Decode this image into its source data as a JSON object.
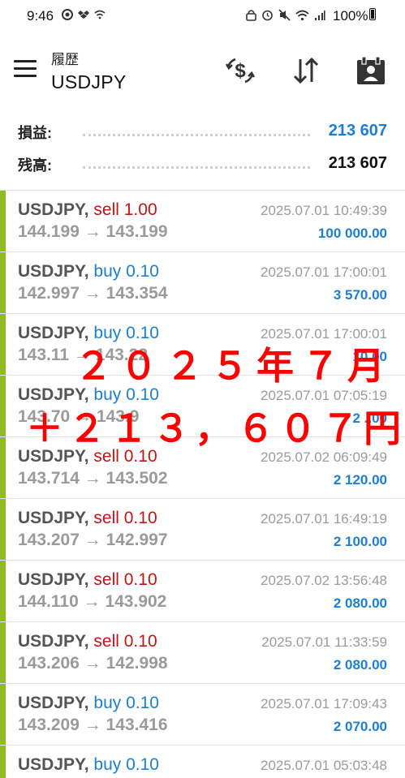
{
  "status_bar": {
    "time": "9:46",
    "battery": "100%"
  },
  "header": {
    "subtitle": "履歴",
    "title": "USDJPY"
  },
  "summary": {
    "profit_label": "損益:",
    "profit_value": "213 607",
    "balance_label": "残高:",
    "balance_value": "213 607"
  },
  "trades": [
    {
      "symbol": "USDJPY,",
      "side": "sell",
      "volume": "1.00",
      "open": "144.199",
      "close": "143.199",
      "time": "2025.07.01 10:49:39",
      "profit": "100 000.00"
    },
    {
      "symbol": "USDJPY,",
      "side": "buy",
      "volume": "0.10",
      "open": "142.997",
      "close": "143.354",
      "time": "2025.07.01 17:00:01",
      "profit": "3 570.00"
    },
    {
      "symbol": "USDJPY,",
      "side": "buy",
      "volume": "0.10",
      "open": "143.11",
      "close": "143.22",
      "time": "2025.07.01 17:00:01",
      "profit": "10.00"
    },
    {
      "symbol": "USDJPY,",
      "side": "buy",
      "volume": "0.10",
      "open": "143.70",
      "close": "143.9",
      "time": "2025.07.01 07:05:19",
      "profit": "2 ..00"
    },
    {
      "symbol": "USDJPY,",
      "side": "sell",
      "volume": "0.10",
      "open": "143.714",
      "close": "143.502",
      "time": "2025.07.02 06:09:49",
      "profit": "2 120.00"
    },
    {
      "symbol": "USDJPY,",
      "side": "sell",
      "volume": "0.10",
      "open": "143.207",
      "close": "142.997",
      "time": "2025.07.01 16:49:19",
      "profit": "2 100.00"
    },
    {
      "symbol": "USDJPY,",
      "side": "sell",
      "volume": "0.10",
      "open": "144.110",
      "close": "143.902",
      "time": "2025.07.02 13:56:48",
      "profit": "2 080.00"
    },
    {
      "symbol": "USDJPY,",
      "side": "sell",
      "volume": "0.10",
      "open": "143.206",
      "close": "142.998",
      "time": "2025.07.01 11:33:59",
      "profit": "2 080.00"
    },
    {
      "symbol": "USDJPY,",
      "side": "buy",
      "volume": "0.10",
      "open": "143.209",
      "close": "143.416",
      "time": "2025.07.01 17:09:43",
      "profit": "2 070.00"
    },
    {
      "symbol": "USDJPY,",
      "side": "buy",
      "volume": "0.10",
      "open": "",
      "close": "",
      "time": "2025.07.01 05:03:48",
      "profit": ""
    }
  ],
  "overlay": {
    "line1": "２０２５年７月",
    "line2": "＋２１３，６０７円"
  },
  "colors": {
    "sell": "#cc1111",
    "buy": "#1a7fd6",
    "profit": "#1a7fd6",
    "accent_bar": "#8fbb1f",
    "overlay": "#ff0000"
  },
  "arrow": "→"
}
